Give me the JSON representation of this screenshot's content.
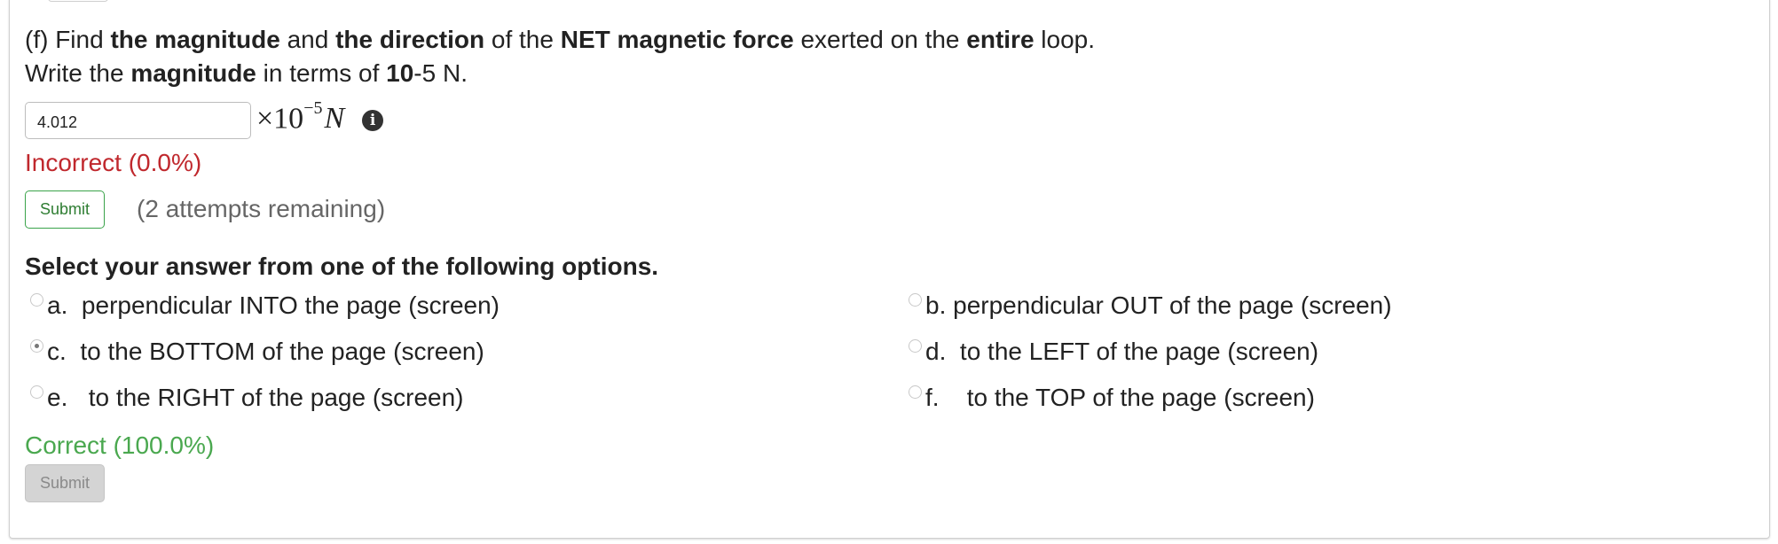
{
  "question": {
    "part_label": "(f) Find ",
    "b1": "the magnitude",
    "t2": " and ",
    "b2": "the direction",
    "t3": " of the ",
    "b3": "NET magnetic force",
    "t4": " exerted on the ",
    "b4": "entire",
    "t5": " loop.",
    "line2_a": "Write the ",
    "line2_b": "magnitude",
    "line2_c": " in terms of ",
    "line2_d": "10",
    "line2_e": "-5 N."
  },
  "magnitude": {
    "input_value": "4.012",
    "unit_prefix": "×10",
    "unit_exponent": "−5",
    "unit_symbol": "N",
    "info_icon": "info-circle-icon",
    "feedback": "Incorrect (0.0%)",
    "submit_label": "Submit",
    "attempts": "(2 attempts remaining)"
  },
  "direction": {
    "heading": "Select your answer from one of the following options.",
    "options": [
      {
        "letter": "a.",
        "text": "perpendicular INTO the page (screen)",
        "selected": false
      },
      {
        "letter": "b.",
        "text": "perpendicular OUT of the page (screen)",
        "selected": false
      },
      {
        "letter": "c.",
        "text": "to the BOTTOM of the page (screen)",
        "selected": true
      },
      {
        "letter": "d.",
        "text": "to the LEFT of the page (screen)",
        "selected": false
      },
      {
        "letter": "e.",
        "text": "to the RIGHT of the page (screen)",
        "selected": false
      },
      {
        "letter": "f.",
        "text": "to the TOP of the page (screen)",
        "selected": false
      }
    ],
    "feedback": "Correct (100.0%)",
    "submit_label": "Submit"
  },
  "colors": {
    "incorrect": "#c0282d",
    "correct": "#4aa84f",
    "submit_border": "#3aa34a"
  }
}
